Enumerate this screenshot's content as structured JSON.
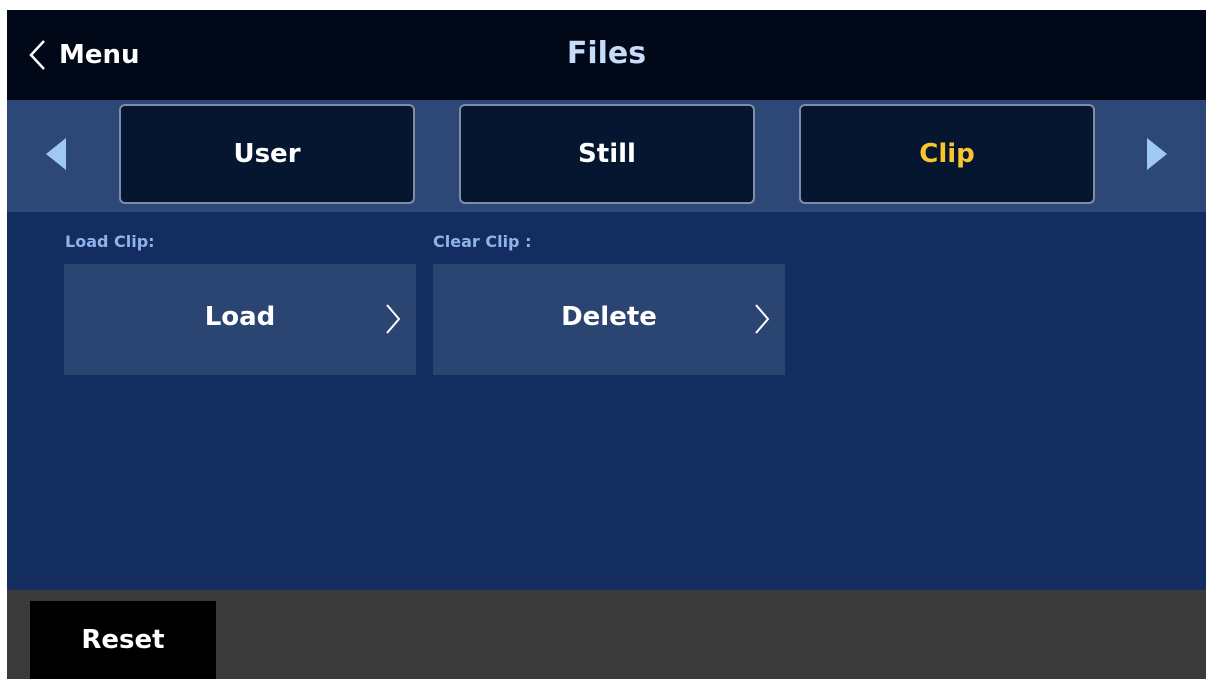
{
  "header": {
    "back_label": "Menu",
    "title": "Files"
  },
  "tabs": [
    {
      "label": "User",
      "active": false
    },
    {
      "label": "Still",
      "active": false
    },
    {
      "label": "Clip",
      "active": true
    }
  ],
  "sections": {
    "load": {
      "label": "Load Clip:",
      "button": "Load"
    },
    "clear": {
      "label": "Clear Clip :",
      "button": "Delete"
    }
  },
  "footer": {
    "reset_label": "Reset"
  },
  "colors": {
    "background": "#132d61",
    "header": "#010817",
    "tabbar": "#2d4877",
    "active_tab_text": "#f8c52d",
    "title_text": "#c6dcf8",
    "section_label": "#8fb2ea",
    "arrow": "#9fc8f5"
  },
  "icons": [
    "chevron-left-icon",
    "triangle-left-icon",
    "triangle-right-icon",
    "chevron-right-icon"
  ]
}
